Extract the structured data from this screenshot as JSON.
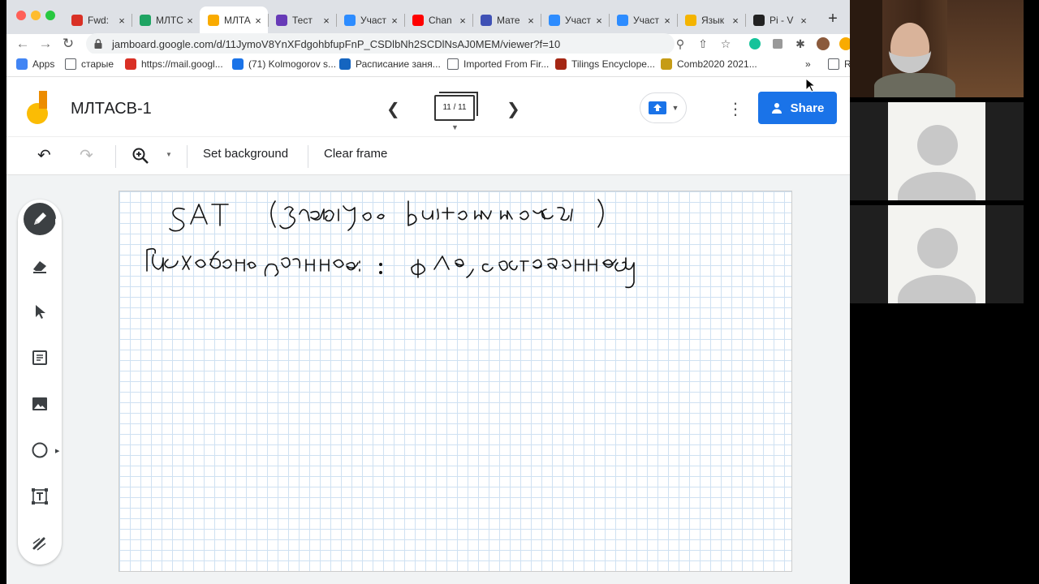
{
  "browser": {
    "tabs": [
      {
        "label": "Fwd: ",
        "favicon": "gmail-icon",
        "color": "#d93025"
      },
      {
        "label": "МЛТС",
        "favicon": "drive-icon",
        "color": "#1fa463"
      },
      {
        "label": "МЛТА",
        "favicon": "jamboard-icon",
        "color": "#f9ab00",
        "active": true
      },
      {
        "label": "Тест",
        "favicon": "forms-icon",
        "color": "#673ab7"
      },
      {
        "label": "Участ",
        "favicon": "zoom-icon",
        "color": "#2d8cff"
      },
      {
        "label": "Chan",
        "favicon": "youtube-icon",
        "color": "#ff0000"
      },
      {
        "label": "Мате",
        "favicon": "math-icon",
        "color": "#3f51b5"
      },
      {
        "label": "Участ",
        "favicon": "zoom-icon",
        "color": "#2d8cff"
      },
      {
        "label": "Участ",
        "favicon": "zoom-icon",
        "color": "#2d8cff"
      },
      {
        "label": "Язык",
        "favicon": "slides-icon",
        "color": "#f4b400"
      },
      {
        "label": "Pi - V",
        "favicon": "wikipedia-icon",
        "color": "#222222"
      }
    ],
    "url": "jamboard.google.com/d/11JymoV8YnXFdgohbfupFnP_CSDlbNh2SCDlNsAJ0MEM/viewer?f=10",
    "bookmarks": [
      {
        "label": "Apps",
        "icon": "apps-grid-icon"
      },
      {
        "label": "старые",
        "icon": "folder-icon"
      },
      {
        "label": "https://mail.googl...",
        "icon": "gmail-icon"
      },
      {
        "label": "(71) Kolmogorov s...",
        "icon": "people-icon"
      },
      {
        "label": "Расписание заня...",
        "icon": "calendar-icon"
      },
      {
        "label": "Imported From Fir...",
        "icon": "folder-icon"
      },
      {
        "label": "Tilings Encyclope...",
        "icon": "tiling-icon"
      },
      {
        "label": "Comb2020 2021...",
        "icon": "comb-icon"
      }
    ],
    "bookmarks_overflow": "»",
    "reading_list": "R"
  },
  "jamboard": {
    "title": "МЛТАСВ-1",
    "frame_counter": "11 / 11",
    "share_label": "Share",
    "toolbar": {
      "set_background": "Set background",
      "clear_frame": "Clear frame"
    },
    "tools": [
      "pen-icon",
      "eraser-icon",
      "select-arrow-icon",
      "sticky-note-icon",
      "image-icon",
      "circle-shape-icon",
      "text-box-icon",
      "laser-icon"
    ]
  },
  "colors": {
    "accent": "#1a73e8",
    "grid": "#cfe1f2",
    "jamboard_orange": "#f9ab00",
    "jamboard_blue": "#4285f4"
  }
}
